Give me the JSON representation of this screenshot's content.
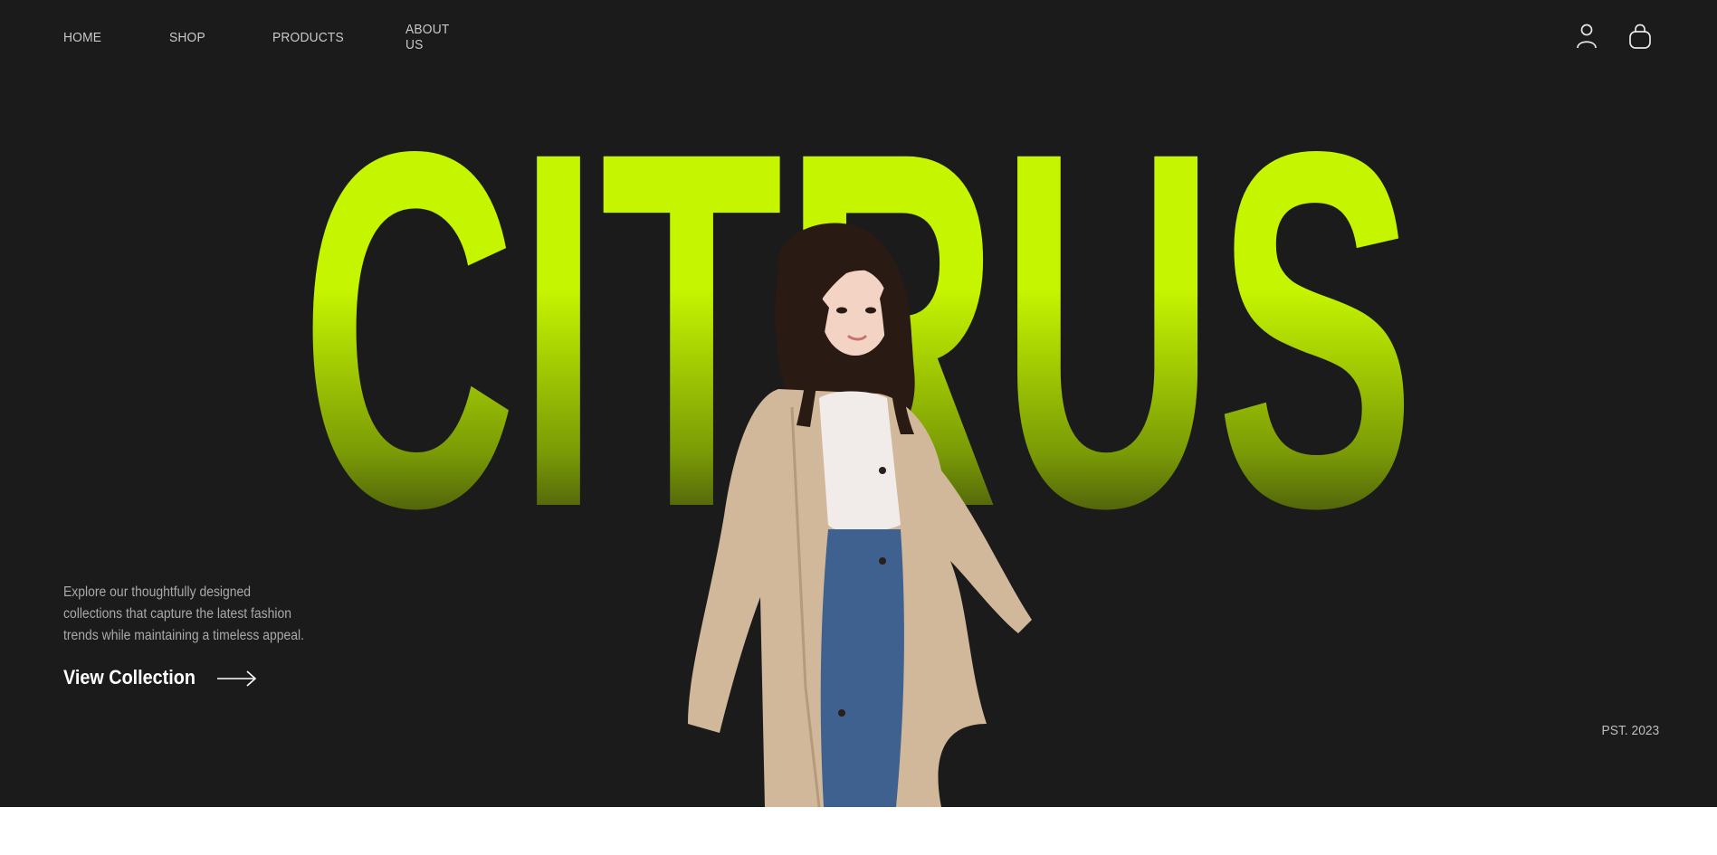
{
  "nav": {
    "items": [
      {
        "label": "HOME"
      },
      {
        "label": "SHOP"
      },
      {
        "label": "PRODUCTS"
      },
      {
        "label": "ABOUT US"
      }
    ]
  },
  "header": {
    "icons": [
      "user-icon",
      "shopping-bag-icon"
    ]
  },
  "hero": {
    "title": "CITRUS",
    "description": "Explore our thoughtfully designed collections that capture the latest fashion trends while maintaining a timeless appeal.",
    "cta_label": "View Collection",
    "established": "PST. 2023"
  },
  "colors": {
    "background": "#1b1b1b",
    "accent": "#c6f500",
    "text_muted": "#a9a9a9",
    "text_light": "#ffffff"
  }
}
